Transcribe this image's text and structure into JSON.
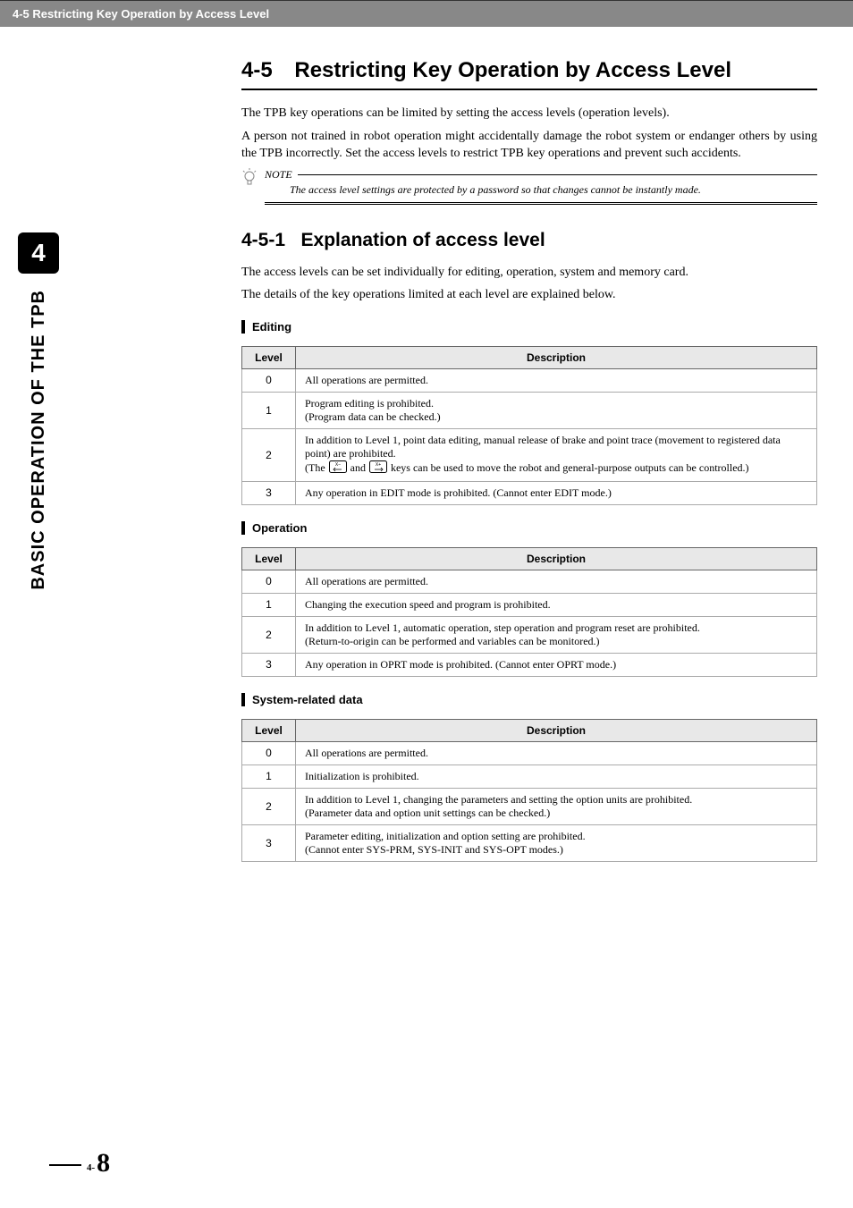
{
  "header": {
    "breadcrumb": "4-5 Restricting Key Operation by Access Level"
  },
  "sidebar": {
    "tab_number": "4",
    "vertical_label": "BASIC OPERATION OF THE TPB"
  },
  "section": {
    "number": "4-5",
    "title": "Restricting Key Operation by Access Level",
    "intro_p1": "The TPB key operations can be limited by setting the access levels (operation levels).",
    "intro_p2": "A person not trained in robot operation might accidentally damage the robot system or endanger others by using the TPB incorrectly. Set the access levels to restrict TPB key operations and prevent such accidents."
  },
  "note": {
    "label": "NOTE",
    "text": "The access level settings are protected by a password so that changes cannot be instantly made."
  },
  "subsection": {
    "number": "4-5-1",
    "title": "Explanation of access level",
    "p1": "The access levels can be set individually for editing, operation, system and memory card.",
    "p2": "The details of the key operations limited at each level are explained below."
  },
  "tables": {
    "col_level": "Level",
    "col_desc": "Description",
    "editing": {
      "heading": "Editing",
      "rows": [
        {
          "level": "0",
          "desc": "All operations are permitted."
        },
        {
          "level": "1",
          "desc_l1": "Program editing is prohibited.",
          "desc_l2": "(Program data can be checked.)"
        },
        {
          "level": "2",
          "desc_l1": "In addition to Level 1, point data editing, manual release of brake and point trace (movement to registered data point) are prohibited.",
          "desc_pre": "(The ",
          "desc_mid": " and ",
          "desc_post": " keys can be used to move the robot and general-purpose outputs can be controlled.)"
        },
        {
          "level": "3",
          "desc": "Any operation in EDIT mode is prohibited. (Cannot enter EDIT mode.)"
        }
      ]
    },
    "operation": {
      "heading": "Operation",
      "rows": [
        {
          "level": "0",
          "desc": "All operations are permitted."
        },
        {
          "level": "1",
          "desc": "Changing the execution speed and program is prohibited."
        },
        {
          "level": "2",
          "desc_l1": "In addition to Level 1, automatic operation, step operation and program reset are prohibited.",
          "desc_l2": "(Return-to-origin can be performed and variables can be monitored.)"
        },
        {
          "level": "3",
          "desc": "Any operation in OPRT mode is prohibited. (Cannot enter OPRT mode.)"
        }
      ]
    },
    "system": {
      "heading": "System-related data",
      "rows": [
        {
          "level": "0",
          "desc": "All operations are permitted."
        },
        {
          "level": "1",
          "desc": "Initialization is prohibited."
        },
        {
          "level": "2",
          "desc_l1": "In addition to Level 1, changing the parameters and setting the option units are prohibited.",
          "desc_l2": "(Parameter data and option unit settings can be checked.)"
        },
        {
          "level": "3",
          "desc_l1": "Parameter editing, initialization and option setting are prohibited.",
          "desc_l2": "(Cannot enter SYS-PRM, SYS-INIT and SYS-OPT modes.)"
        }
      ]
    }
  },
  "footer": {
    "chapter": "4-",
    "page": "8"
  }
}
